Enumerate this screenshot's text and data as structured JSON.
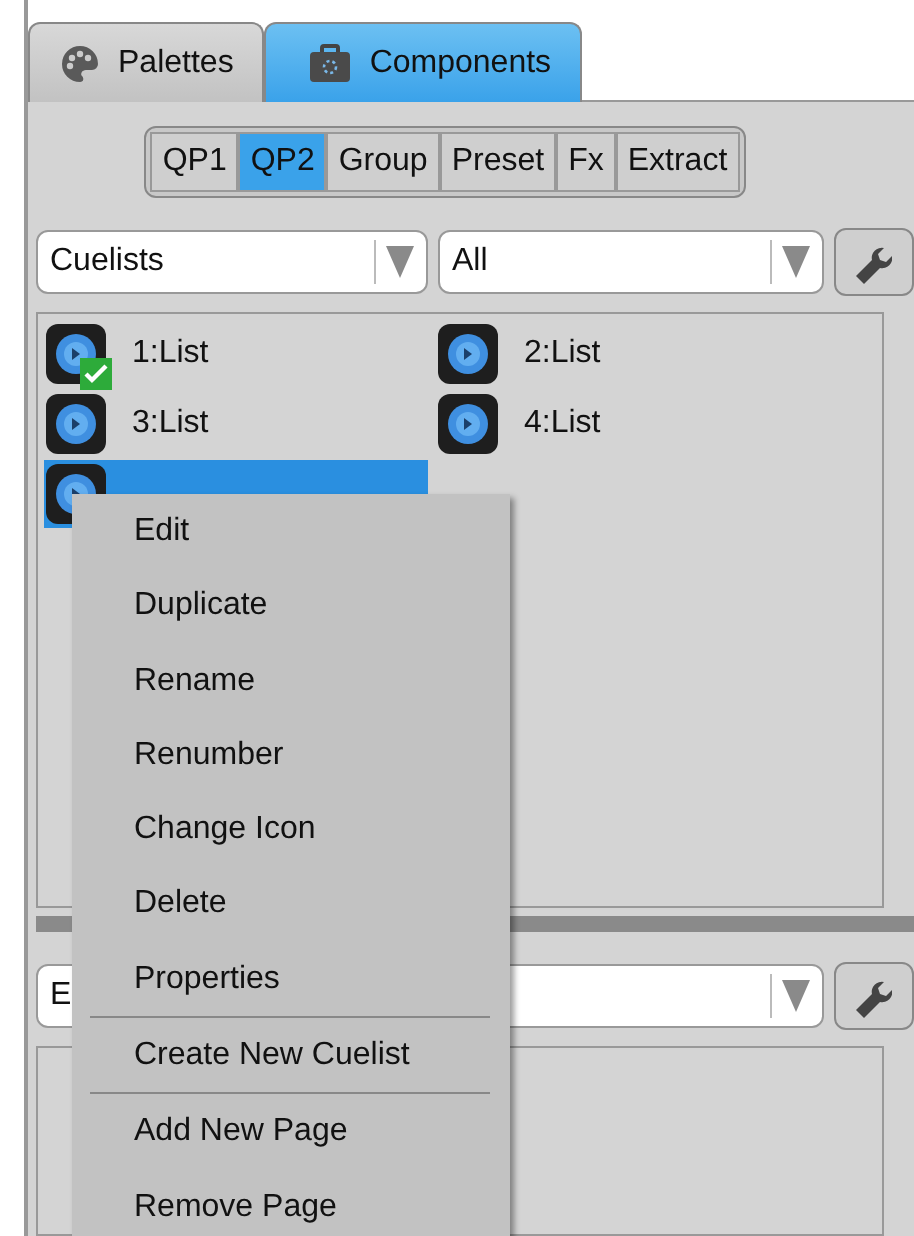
{
  "tabs": [
    {
      "label": "Palettes",
      "kind": "palette",
      "selected": false
    },
    {
      "label": "Components",
      "kind": "case",
      "selected": true
    }
  ],
  "segments": [
    {
      "label": "QP1",
      "selected": false
    },
    {
      "label": "QP2",
      "selected": true
    },
    {
      "label": "Group",
      "selected": false
    },
    {
      "label": "Preset",
      "selected": false
    },
    {
      "label": "Fx",
      "selected": false
    },
    {
      "label": "Extract",
      "selected": false
    }
  ],
  "filters": [
    {
      "value": "Cuelists"
    },
    {
      "value": "All"
    }
  ],
  "cuelists": [
    {
      "label": "1:List",
      "checked": true,
      "selected": false
    },
    {
      "label": "2:List",
      "checked": false,
      "selected": false
    },
    {
      "label": "3:List",
      "checked": false,
      "selected": false
    },
    {
      "label": "4:List",
      "checked": false,
      "selected": false
    },
    {
      "checked": false,
      "selected": true
    }
  ],
  "lower_filter": {
    "value": "E"
  },
  "context_menu": [
    {
      "label": "Edit",
      "separator_before": false
    },
    {
      "label": "Duplicate",
      "separator_before": false
    },
    {
      "label": "Rename",
      "separator_before": false
    },
    {
      "label": "Renumber",
      "separator_before": false
    },
    {
      "label": "Change Icon",
      "separator_before": false
    },
    {
      "label": "Delete",
      "separator_before": false
    },
    {
      "label": "Properties",
      "separator_before": false
    },
    {
      "label": "Create New Cuelist",
      "separator_before": true
    },
    {
      "label": "Add New Page",
      "separator_before": true
    },
    {
      "label": "Remove Page",
      "separator_before": false
    }
  ]
}
